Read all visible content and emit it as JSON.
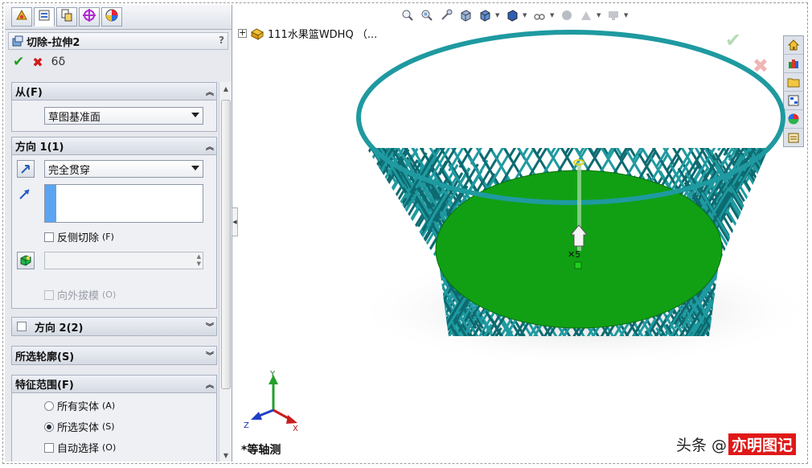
{
  "property_manager": {
    "title": "切除-拉伸2",
    "help": "?",
    "actions": {
      "ok": "✔",
      "cancel": "✖",
      "preview": "6δ"
    }
  },
  "groups": {
    "from": {
      "title": "从(F)",
      "value": "草图基准面"
    },
    "direction1": {
      "title": "方向 1(1)",
      "end_condition": "完全贯穿",
      "flip_side_label": "反侧切除",
      "flip_side_key": "(F)",
      "draft_outward_label": "向外拔模",
      "draft_outward_key": "(O)"
    },
    "direction2": {
      "title": "方向 2(2)"
    },
    "selected_contours": {
      "title": "所选轮廓(S)"
    },
    "feature_scope": {
      "title": "特征范围(F)",
      "all_bodies": "所有实体",
      "all_bodies_key": "(A)",
      "selected_bodies": "所选实体",
      "selected_bodies_key": "(S)",
      "auto_select": "自动选择",
      "auto_select_key": "(O)"
    }
  },
  "graphics": {
    "tree_item": "111水果篮WDHQ （...",
    "view_orientation": "*等轴测",
    "triad": {
      "x": "X",
      "y": "Y",
      "z": "Z"
    },
    "confirm_ok": "✔",
    "confirm_cancel": "✖"
  },
  "watermark": {
    "left": "头条 @",
    "right": "亦明图记"
  },
  "colors": {
    "basket": "#1e9aa0",
    "basket_dark": "#0d6a70",
    "base_fill": "#11a014",
    "panel_bg": "#e7e9ee",
    "watermark_red": "#e01818"
  },
  "icons": {
    "manager_tabs": [
      "feature-manager-icon",
      "property-manager-icon",
      "configuration-manager-icon",
      "dimxpert-icon",
      "display-manager-icon"
    ],
    "task_pane": [
      "home-icon",
      "design-library-icon",
      "file-explorer-icon",
      "view-palette-icon",
      "appearances-icon",
      "custom-properties-icon"
    ]
  }
}
